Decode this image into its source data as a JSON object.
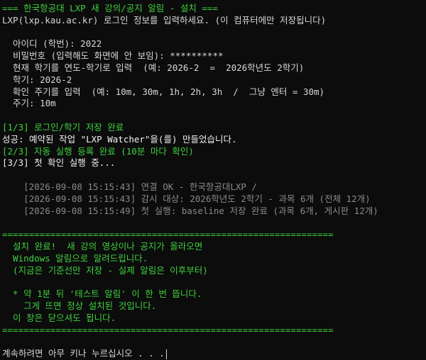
{
  "header": {
    "title": "=== 한국항공대 LXP 새 강의/공지 알림 - 설치 ===",
    "prompt": "LXP(lxp.kau.ac.kr) 로그인 정보를 입력하세요. (이 컴퓨터에만 저장됩니다)"
  },
  "inputs": {
    "id_line": "  아이디 (학번): 2022",
    "password_line": "  비밀번호 (입력해도 화면에 안 보임): **********",
    "semester_prompt": "  현재 학기를 연도-학기로 입력  (예: 2026-2  =  2026학년도 2학기)",
    "semester_value": "  학기: 2026-2",
    "interval_prompt": "  확인 주기를 입력  (예: 10m, 30m, 1h, 2h, 3h  /  그냥 엔터 = 30m)",
    "interval_value": "  주기: 10m"
  },
  "steps": {
    "step1": "[1/3] 로그인/학기 저장 완료",
    "task_created": "성공: 예약된 작업 \"LXP Watcher\"을(를) 만들었습니다.",
    "step2": "[2/3] 자동 실행 등록 완료 (10분 마다 확인)",
    "step3": "[3/3] 첫 확인 실행 중..."
  },
  "log": [
    "    [2026-09-08 15:15:43] 연결 OK - 한국항공대LXP /",
    "    [2026-09-08 15:15:43] 감시 대상: 2026학년도 2학기 - 과목 6개 (전체 12개)",
    "    [2026-09-08 15:15:49] 첫 실행: baseline 저장 완료 (과목 6개, 게시판 12개)"
  ],
  "summary": {
    "divider": "==============================================================",
    "complete_1": "  설치 완료!  새 강의 영상이나 공지가 올라오면",
    "complete_2": "  Windows 알림으로 알려드립니다.",
    "complete_3": "  (지금은 기준선만 저장 - 실제 알림은 이후부터)",
    "note_1": "  * 약 1분 뒤 '테스트 알림' 이 한 번 뜹니다.",
    "note_2": "    그게 뜨면 정상 설치된 것입니다.",
    "note_3": "  이 창은 닫으셔도 됩니다."
  },
  "footer": {
    "pause_prompt": "계속하려면 아무 키나 누르십시오 . . ."
  },
  "colors": {
    "background": "#0c0c0c",
    "text": "#d8d8d8",
    "accent_green": "#3fd13f",
    "log_gray": "#8a8a8a"
  }
}
